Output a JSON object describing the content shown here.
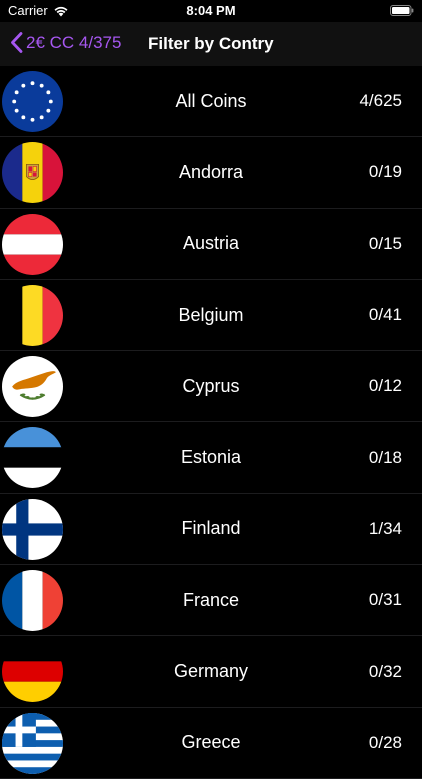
{
  "status_bar": {
    "carrier": "Carrier",
    "time": "8:04 PM",
    "wifi_icon": "wifi-icon",
    "battery_icon": "battery-icon"
  },
  "nav": {
    "back_label": "2€ CC 4/375",
    "title": "Filter by Contry",
    "accent_color": "#a657f0"
  },
  "rows": [
    {
      "name": "All Coins",
      "count": "4/625",
      "flag": "eu-flag-icon"
    },
    {
      "name": "Andorra",
      "count": "0/19",
      "flag": "andorra-flag-icon"
    },
    {
      "name": "Austria",
      "count": "0/15",
      "flag": "austria-flag-icon"
    },
    {
      "name": "Belgium",
      "count": "0/41",
      "flag": "belgium-flag-icon"
    },
    {
      "name": "Cyprus",
      "count": "0/12",
      "flag": "cyprus-flag-icon"
    },
    {
      "name": "Estonia",
      "count": "0/18",
      "flag": "estonia-flag-icon"
    },
    {
      "name": "Finland",
      "count": "1/34",
      "flag": "finland-flag-icon"
    },
    {
      "name": "France",
      "count": "0/31",
      "flag": "france-flag-icon"
    },
    {
      "name": "Germany",
      "count": "0/32",
      "flag": "germany-flag-icon"
    },
    {
      "name": "Greece",
      "count": "0/28",
      "flag": "greece-flag-icon"
    }
  ]
}
